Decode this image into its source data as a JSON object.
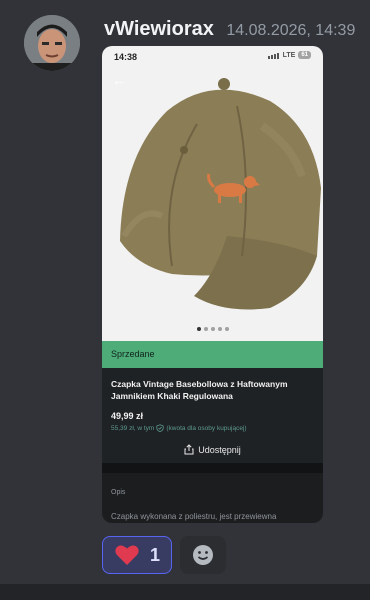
{
  "message": {
    "author": "vWiewiorax",
    "timestamp": "14.08.2026, 14:39",
    "reaction": {
      "emoji": "heart-icon",
      "count": "1"
    },
    "add_reaction_icon": "smile-icon"
  },
  "phone": {
    "time": "14:38",
    "network": "LTE",
    "battery": "61"
  },
  "listing": {
    "status": "Sprzedane",
    "title": "Czapka Vintage Basebollowa z Haftowanym Jamnikiem Khaki Regulowana",
    "price": "49,99 zł",
    "buyer_price": "55,39 zł, w tym",
    "buyer_note": "(kwota dla osoby kupującej)",
    "share": "Udostępnij",
    "section_label": "Opis",
    "description": "Czapka wykonana z poliestru, jest przewiewna",
    "photo_count": 5,
    "active_photo": 1
  },
  "colors": {
    "sold_banner": "#4dac78",
    "reaction_border": "#5865f2",
    "heart": "#e03a50",
    "cap": "#8b7d55"
  }
}
